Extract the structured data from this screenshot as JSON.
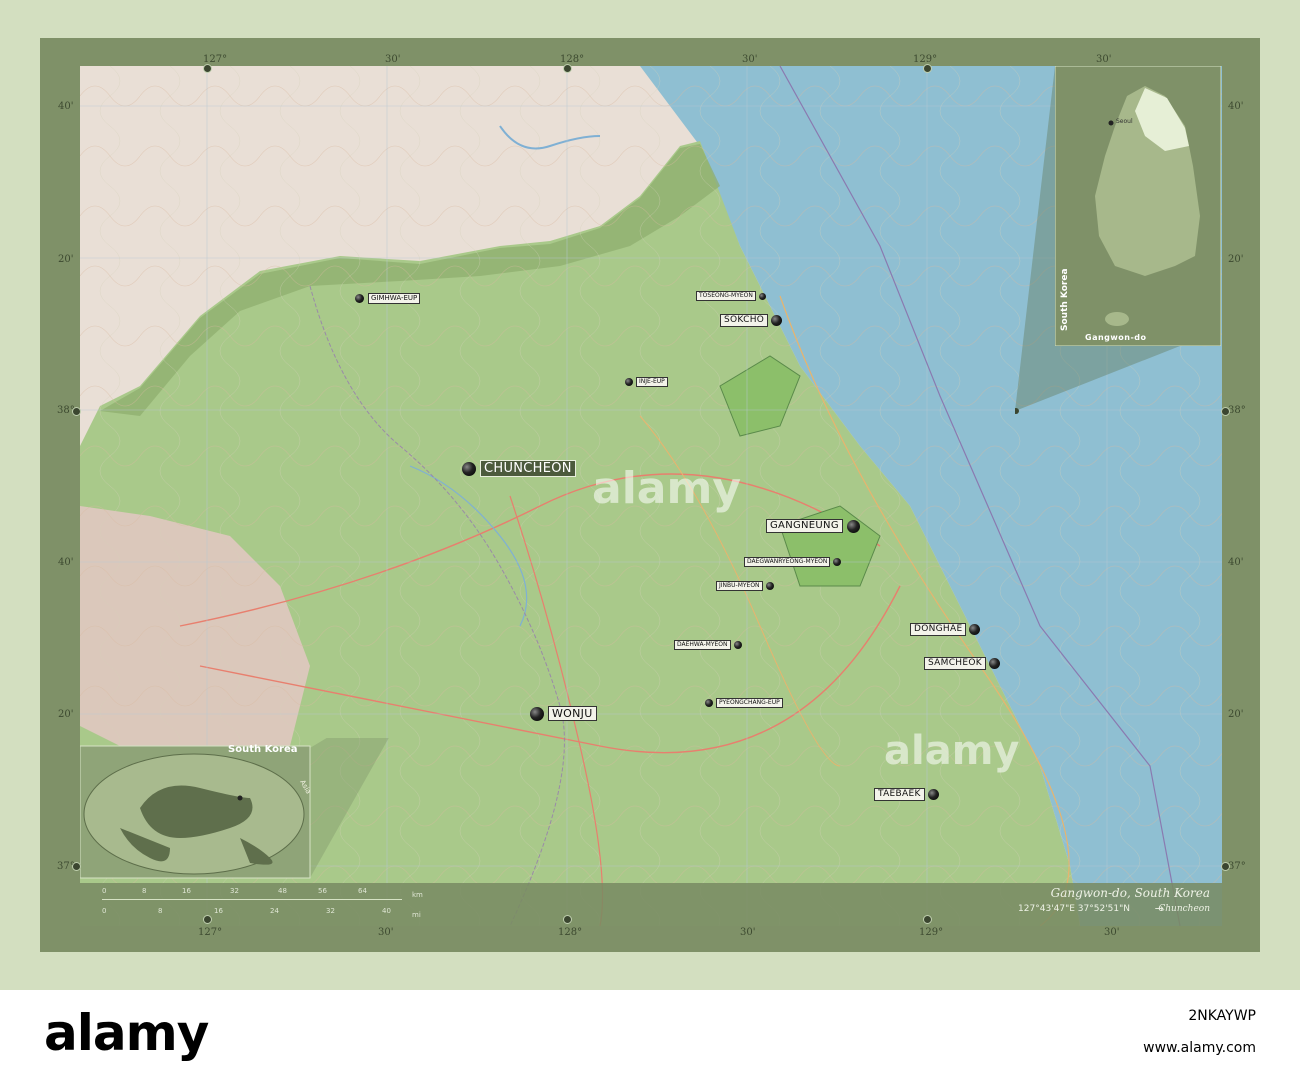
{
  "map": {
    "region_name": "Gangwon-do, South Korea",
    "coordinates": "127°43'47\"E  37°52'51\"N",
    "arrow": "→",
    "capital": "Chuncheon"
  },
  "ticks": {
    "top": [
      "127°",
      "30'",
      "128°",
      "30'",
      "129°",
      "30'"
    ],
    "bottom": [
      "127°",
      "30'",
      "128°",
      "30'",
      "129°",
      "30'"
    ],
    "left": [
      "40'",
      "20'",
      "38°",
      "40'",
      "20'",
      "37°"
    ],
    "right": [
      "40'",
      "20'",
      "38°",
      "40'",
      "20'",
      "37°"
    ]
  },
  "cities": {
    "chuncheon": "Chuncheon",
    "gangneung": "Gangneung",
    "wonju": "Wonju",
    "sokcho": "Sokcho",
    "donghae": "Donghae",
    "samcheok": "Samcheok",
    "taebaek": "Taebaek",
    "gimhwa": "Gimhwa-eup",
    "toseong": "Toseong-myeon",
    "inje": "Inje-eup",
    "daegwallyeong": "Daegwanryeong-myeon",
    "jinbu": "Jinbu-myeon",
    "daehwa": "Daehwa-myeon",
    "pyeongchang": "Pyeongchang-eup"
  },
  "insets": {
    "world_label": "South Korea",
    "world_side": "Asia",
    "korea_label": "South Korea",
    "korea_region": "Gangwon-do",
    "seoul": "Seoul"
  },
  "scale": {
    "km_label": "km",
    "mi_label": "mi",
    "km": [
      "0",
      "8",
      "16",
      "32",
      "48",
      "56",
      "64"
    ],
    "mi": [
      "0",
      "8",
      "16",
      "24",
      "32",
      "40"
    ]
  },
  "watermark": {
    "text": "alamy",
    "image_id": "2NKAYWP",
    "url": "www.alamy.com"
  },
  "colors": {
    "land": "#a9c98a",
    "sea": "#8fbfd2",
    "frame": "#7f9168",
    "background": "#d3dfc0"
  }
}
